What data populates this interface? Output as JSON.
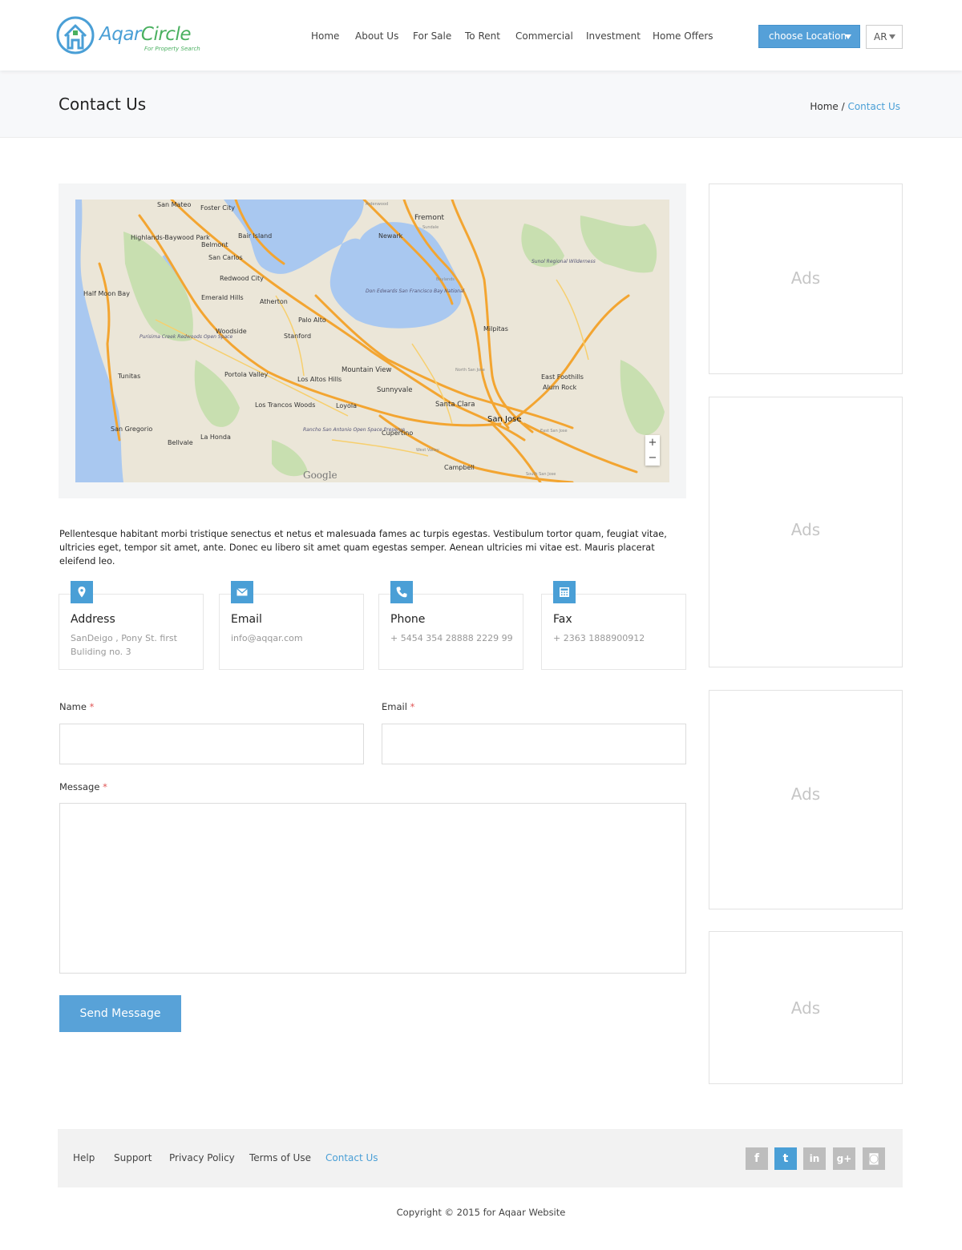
{
  "brand": {
    "name_part1": "Aqar",
    "name_part2": "Circle",
    "tagline": "For Property Search",
    "color_blue": "#4a9fd6",
    "color_green": "#4ab060"
  },
  "nav": {
    "items": [
      "Home",
      "About Us",
      "For Sale",
      "To Rent",
      "Commercial",
      "Investment",
      "Home Offers"
    ]
  },
  "header": {
    "location_button": "choose Location",
    "language": "AR"
  },
  "page": {
    "title": "Contact Us",
    "breadcrumb_home": "Home",
    "breadcrumb_sep": " / ",
    "breadcrumb_current": "Contact Us"
  },
  "map": {
    "labels": [
      "San Mateo",
      "Foster City",
      "Fremont",
      "Newark",
      "Bair Island",
      "Belmont",
      "San Carlos",
      "Highlands-Baywood Park",
      "Redwood City",
      "Emerald Hills",
      "Atherton",
      "Half Moon Bay",
      "Palo Alto",
      "Woodside",
      "Stanford",
      "Don Edwards San Francisco Bay National",
      "Purisima Creek Redwoods Open Space",
      "Milpitas",
      "Sunol Regional Wilderness",
      "Mountain View",
      "Portola Valley",
      "Los Altos Hills",
      "Tunitas",
      "Sunnyvale",
      "Santa Clara",
      "San Jose",
      "East Foothills",
      "Alum Rock",
      "Loyola",
      "Los Trancos Woods",
      "Cupertino",
      "San Gregorio",
      "La Honda",
      "Bellvale",
      "Rancho San Antonio Open Space Preserve",
      "Campbell",
      "North San Jose",
      "Baylands",
      "Ardenwood",
      "Sundale",
      "West Valley",
      "South San Jose",
      "East San Jose"
    ],
    "zoom_in": "+",
    "zoom_out": "−",
    "attribution": "Google"
  },
  "intro": "Pellentesque habitant morbi tristique senectus et netus et malesuada fames ac turpis egestas. Vestibulum tortor quam, feugiat vitae, ultricies eget, tempor sit amet, ante. Donec eu libero sit amet quam egestas semper. Aenean ultricies mi vitae est. Mauris placerat eleifend leo.",
  "contacts": [
    {
      "icon": "map-pin-icon",
      "title": "Address",
      "line1": "SanDeigo , Pony St. first",
      "line2": "Buliding no. 3"
    },
    {
      "icon": "envelope-icon",
      "title": "Email",
      "line1": "info@aqqar.com",
      "line2": ""
    },
    {
      "icon": "phone-icon",
      "title": "Phone",
      "line1": "+ 5454 354 28888 2229 99",
      "line2": ""
    },
    {
      "icon": "fax-icon",
      "title": "Fax",
      "line1": "+ 2363 1888900912",
      "line2": ""
    }
  ],
  "form": {
    "name_label": "Name",
    "email_label": "Email",
    "message_label": "Message",
    "required_mark": "*",
    "name_value": "",
    "email_value": "",
    "message_value": "",
    "submit": "Send Message"
  },
  "ads": [
    "Ads",
    "Ads",
    "Ads",
    "Ads"
  ],
  "footer": {
    "links": [
      "Help",
      "Support",
      "Privacy Policy",
      "Terms of Use",
      "Contact Us"
    ],
    "social": [
      {
        "icon": "facebook-icon",
        "glyph": "f"
      },
      {
        "icon": "twitter-icon",
        "glyph": "t"
      },
      {
        "icon": "linkedin-icon",
        "glyph": "in"
      },
      {
        "icon": "google-plus-icon",
        "glyph": "g+"
      },
      {
        "icon": "instagram-icon",
        "glyph": "◙"
      }
    ],
    "copyright": "Copyright © 2015 for Aqaar Website"
  }
}
